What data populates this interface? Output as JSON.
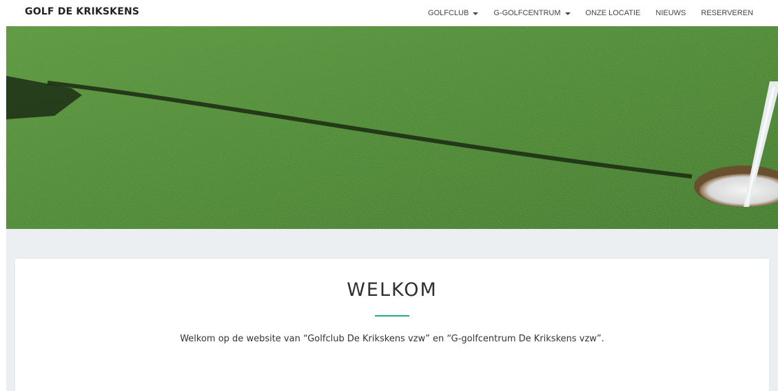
{
  "brand": {
    "name": "GOLF DE KRIKSKENS"
  },
  "nav": {
    "items": [
      {
        "label": "GOLFCLUB",
        "dropdown": true
      },
      {
        "label": "G-GOLFCENTRUM",
        "dropdown": true
      },
      {
        "label": "ONZE LOCATIE",
        "dropdown": false
      },
      {
        "label": "NIEUWS",
        "dropdown": false
      },
      {
        "label": "RESERVEREN",
        "dropdown": false
      }
    ]
  },
  "welcome": {
    "title": "WELKOM",
    "text": "Welkom op de website van “Golfclub De Krikskens vzw” en “G-golfcentrum De Krikskens vzw”."
  },
  "colors": {
    "accent": "#2aa889",
    "grass": "#3f7f2a",
    "section_bg": "#eceff1"
  }
}
